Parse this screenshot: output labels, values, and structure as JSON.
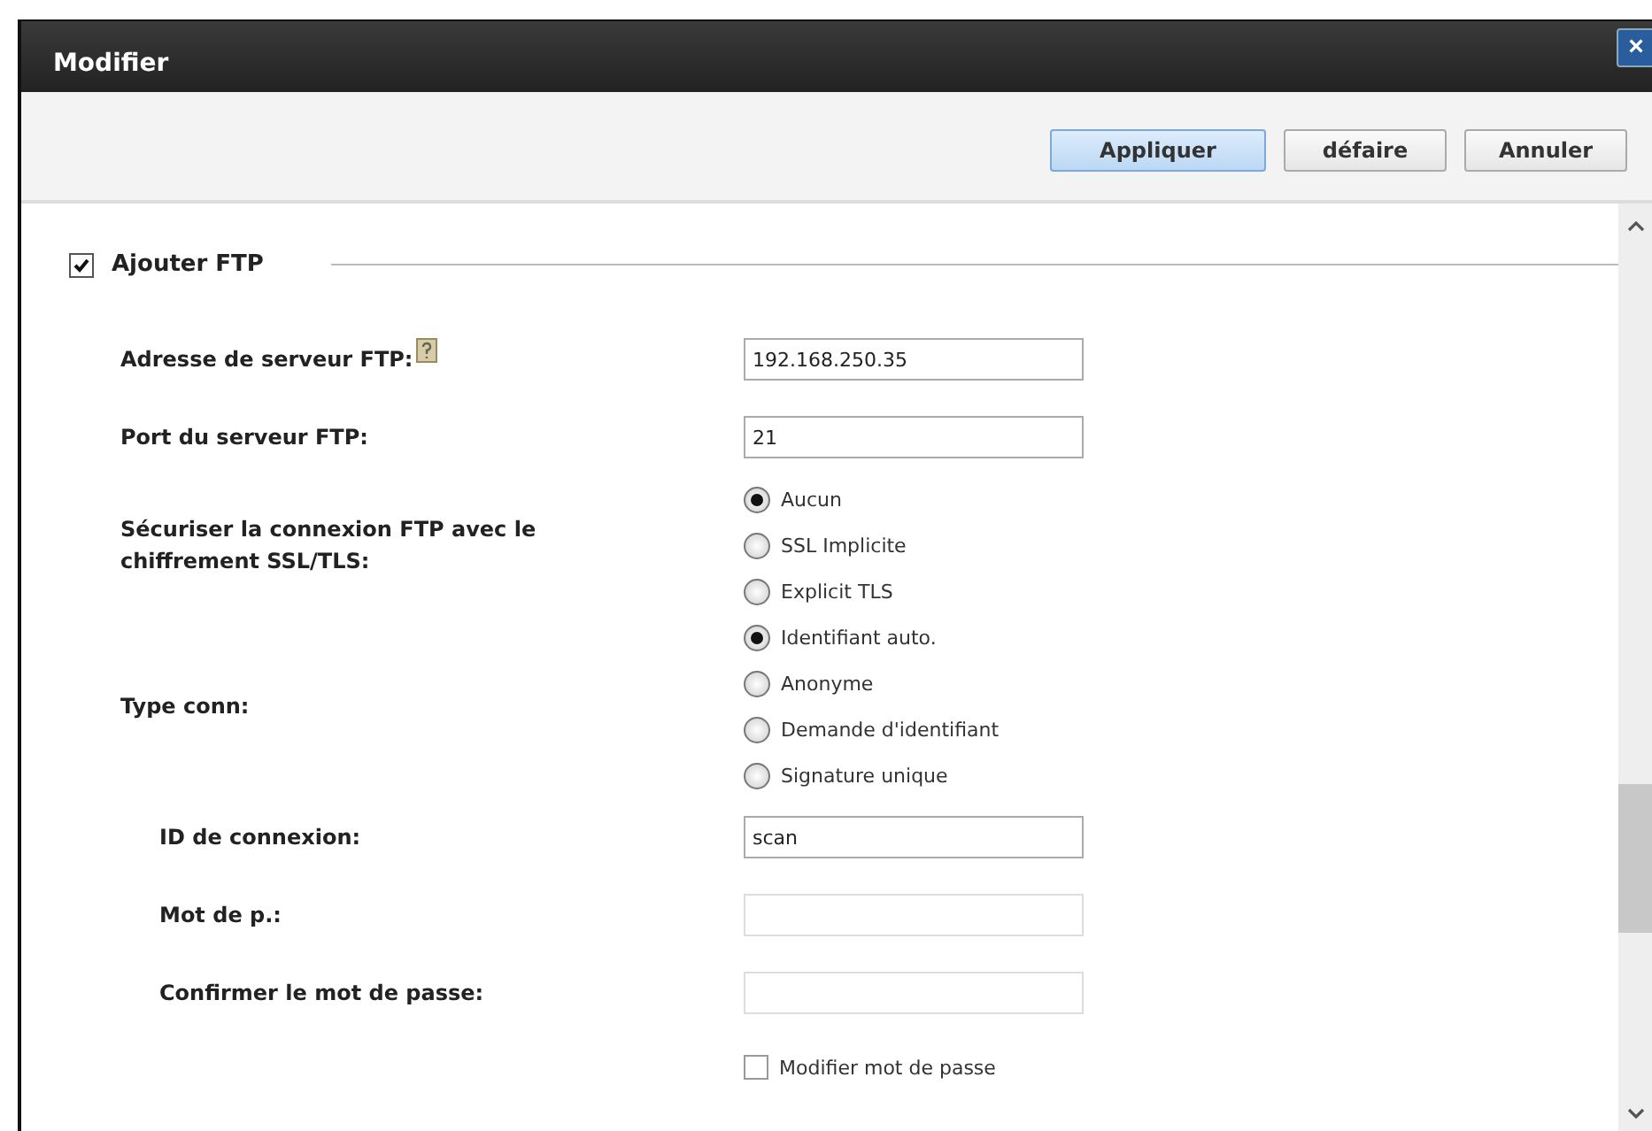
{
  "window": {
    "title": "Modifier",
    "close": "×"
  },
  "buttons": [
    {
      "label": "Appliquer",
      "primary": true
    },
    {
      "label": "défaire",
      "primary": false
    },
    {
      "label": "Annuler",
      "primary": false
    }
  ],
  "section": {
    "label": "Ajouter FTP",
    "checked": true
  },
  "rows": [
    {
      "kind": "text",
      "label": "Adresse de serveur FTP:",
      "help": true,
      "sub": false,
      "value": "192.168.250.35",
      "disabled": false
    },
    {
      "kind": "text",
      "label": "Port du serveur FTP:",
      "help": false,
      "sub": false,
      "value": "21",
      "disabled": false
    },
    {
      "kind": "radio",
      "label": "Sécuriser la connexion FTP avec le chiffrement SSL/TLS:",
      "sub": false,
      "options": [
        {
          "label": "Aucun",
          "selected": true
        },
        {
          "label": "SSL Implicite",
          "selected": false
        },
        {
          "label": "Explicit TLS",
          "selected": false
        }
      ]
    },
    {
      "kind": "radio",
      "label": "Type conn:",
      "sub": false,
      "options": [
        {
          "label": "Identifiant auto.",
          "selected": true
        },
        {
          "label": "Anonyme",
          "selected": false
        },
        {
          "label": "Demande d'identifiant",
          "selected": false
        },
        {
          "label": "Signature unique",
          "selected": false
        }
      ]
    },
    {
      "kind": "text",
      "label": "ID de connexion:",
      "help": false,
      "sub": true,
      "value": "scan",
      "disabled": false
    },
    {
      "kind": "text",
      "label": "Mot de p.:",
      "help": false,
      "sub": true,
      "disabled": true
    },
    {
      "kind": "text",
      "label": "Confirmer le mot de passe:",
      "help": false,
      "sub": true,
      "disabled": true
    },
    {
      "kind": "checkbox",
      "label": "Modifier mot de passe",
      "checked": false
    }
  ]
}
